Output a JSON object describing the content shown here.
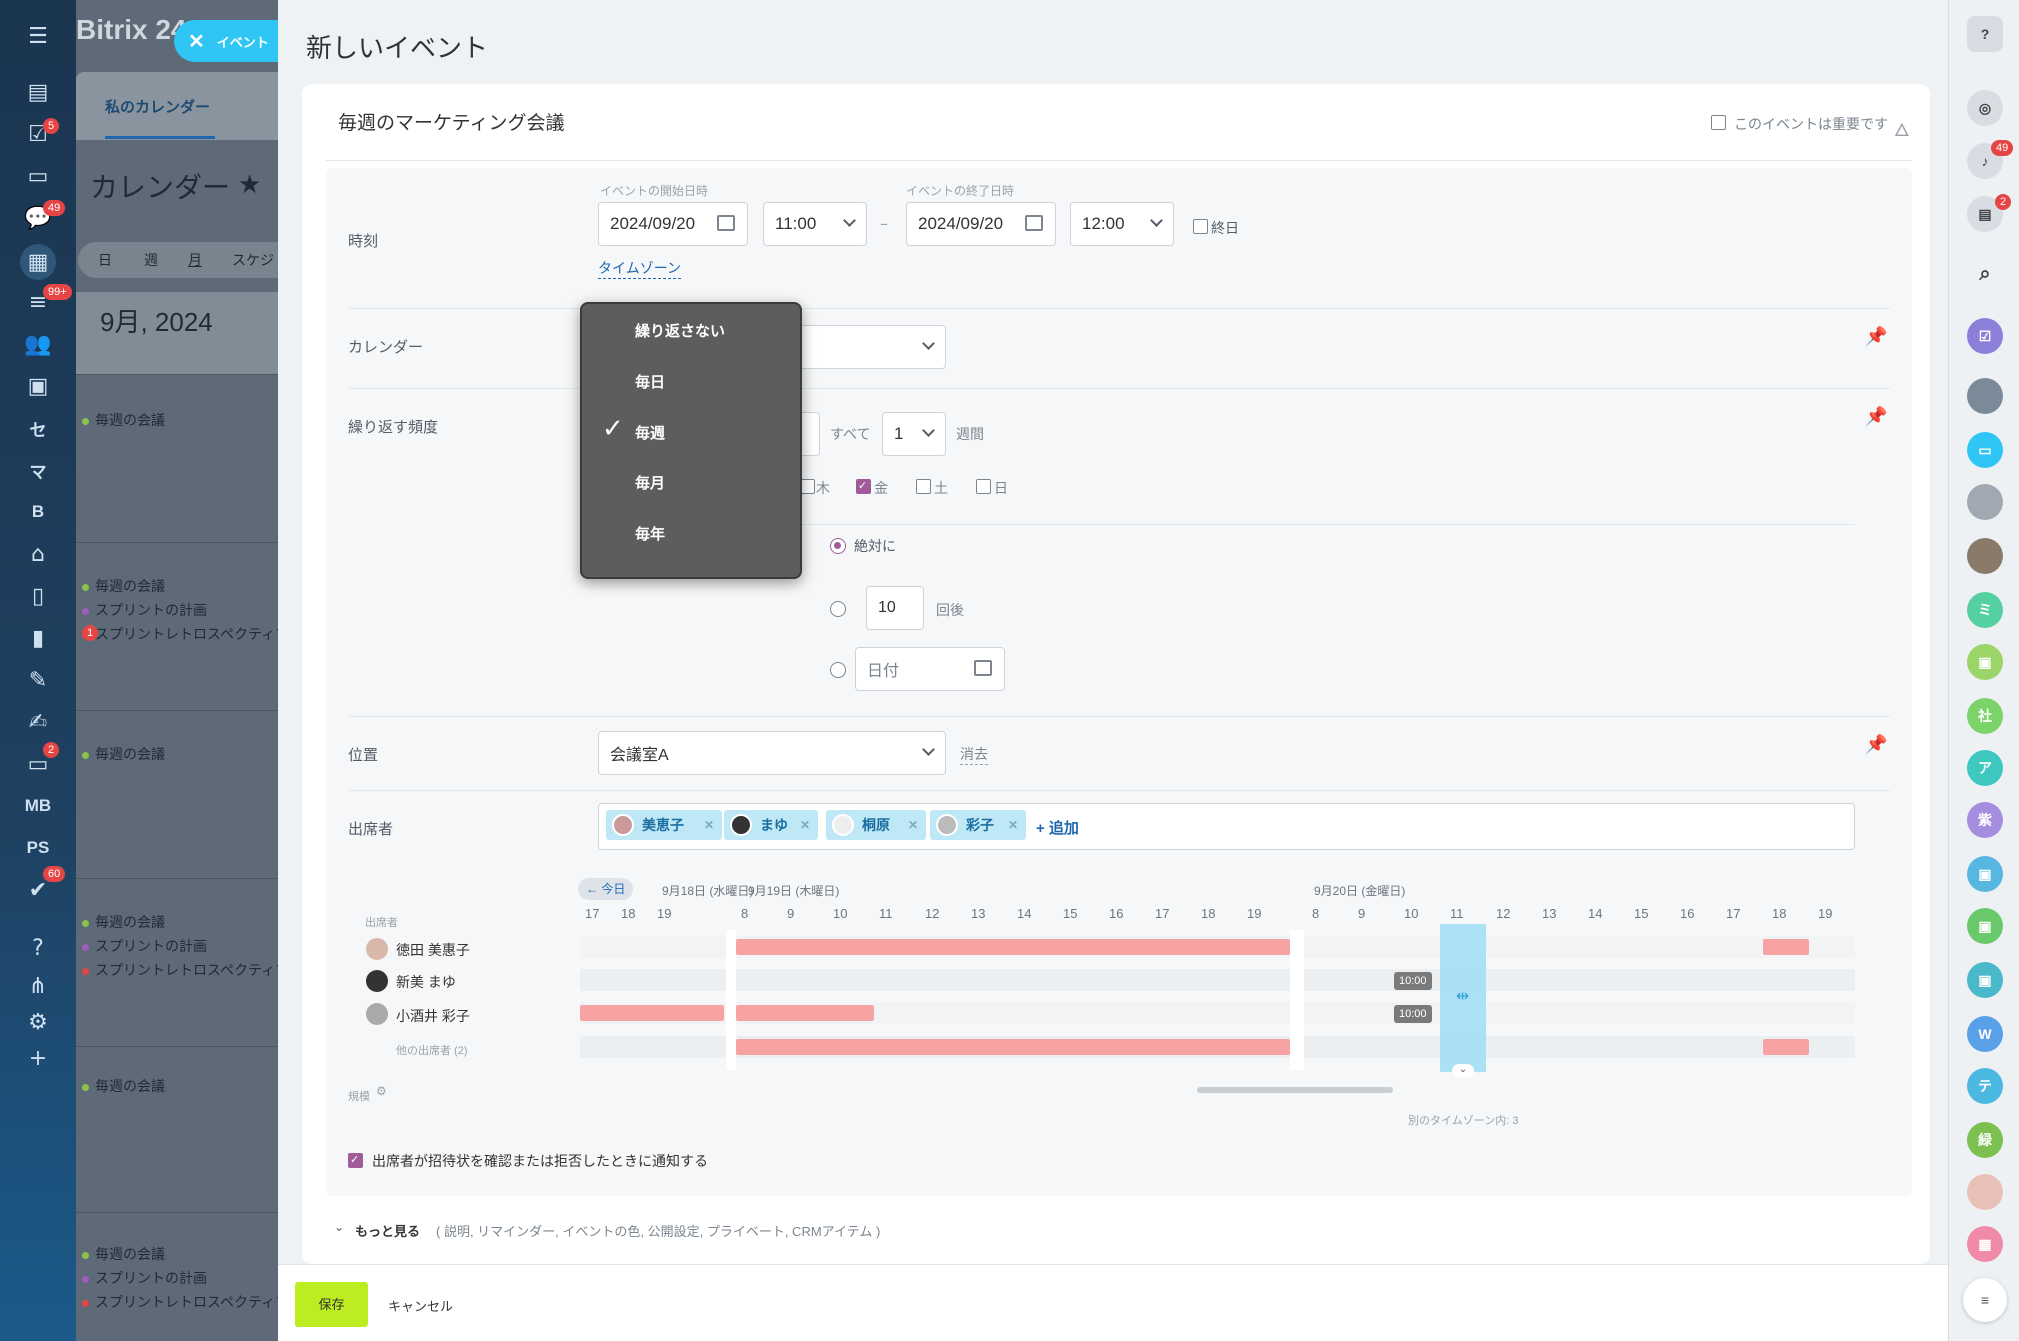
{
  "app": {
    "logo": "Bitrix 24",
    "close_tab": "イベント",
    "tab_label": "私のカレンダー"
  },
  "left_nav": {
    "badges": [
      "5",
      "49",
      "99+",
      "2",
      "60"
    ],
    "text_icons": [
      "セ",
      "マ",
      "B",
      "MB",
      "PS"
    ]
  },
  "calendar_bg": {
    "title": "カレンダー",
    "views": [
      "日",
      "週",
      "月",
      "スケジ"
    ],
    "month": "9月, 2024",
    "events": [
      "毎週の会議",
      "毎週の会議",
      "スプリントの計画",
      "スプリントレトロスペクティブ",
      "毎週の会議",
      "毎週の会議",
      "スプリントの計画",
      "スプリントレトロスペクティブ",
      "毎週の会議",
      "毎週の会議",
      "スプリントの計画",
      "スプリントレトロスペクティブ"
    ],
    "warn_badge": "1"
  },
  "page": {
    "title": "新しいイベント"
  },
  "event": {
    "name": "毎週のマーケティング会議",
    "important_label": "このイベントは重要です"
  },
  "time": {
    "label": "時刻",
    "start_caption": "イベントの開始日時",
    "end_caption": "イベントの終了日時",
    "start_date": "2024/09/20",
    "start_time": "11:00",
    "end_date": "2024/09/20",
    "end_time": "12:00",
    "dash": "–",
    "allday": "終日",
    "timezone": "タイムゾーン"
  },
  "calendar": {
    "label": "カレンダー"
  },
  "repeat": {
    "label": "繰り返す頻度",
    "every": "すべて",
    "interval": "1",
    "unit": "週間",
    "days": [
      "木",
      "金",
      "土",
      "日"
    ],
    "end_never": "絶対に",
    "end_count": "10",
    "end_count_suffix": "回後",
    "end_date_placeholder": "日付"
  },
  "menu": {
    "items": [
      "繰り返さない",
      "毎日",
      "毎週",
      "毎月",
      "毎年"
    ],
    "checked": "毎週"
  },
  "location": {
    "label": "位置",
    "value": "会議室A",
    "clear": "消去"
  },
  "attendees": {
    "label": "出席者",
    "tags": [
      "美恵子",
      "まゆ",
      "桐原",
      "彩子"
    ],
    "add": "+ 追加"
  },
  "planner": {
    "today": "← 今日",
    "dates": [
      "9月18日 (水曜日)",
      "9月19日 (木曜日)",
      "9月20日 (金曜日)"
    ],
    "hours1": [
      "17",
      "18",
      "19"
    ],
    "hours2": [
      "8",
      "9",
      "10",
      "11",
      "12",
      "13",
      "14",
      "15",
      "16",
      "17",
      "18",
      "19"
    ],
    "hours3": [
      "8",
      "9",
      "10",
      "11",
      "12",
      "13",
      "14",
      "15",
      "16",
      "17",
      "18",
      "19"
    ],
    "col_header": "出席者",
    "people": [
      "徳田 美惠子",
      "新美 まゆ",
      "小酒井 彩子"
    ],
    "others": "他の出席者 (2)",
    "slot_time": "10:00",
    "scale": "規模",
    "tz_note": "別のタイムゾーン内: 3"
  },
  "notify": {
    "label": "出席者が招待状を確認または拒否したときに通知する"
  },
  "more": {
    "label": "もっと見る",
    "detail": "( 説明,  リマインダー,  イベントの色,  公開設定,  プライベート,  CRMアイテム )"
  },
  "footer": {
    "save": "保存",
    "cancel": "キャンセル"
  },
  "right_bar": {
    "badges": [
      "49",
      "2"
    ],
    "avatars": [
      "ミ",
      "社",
      "ア",
      "紫",
      "W",
      "テ",
      "緑"
    ]
  },
  "colors": {
    "accent": "#2fc6f6",
    "save_green": "#bbed21",
    "busy": "#f8a3a3",
    "checkbox": "#a05c9a"
  }
}
